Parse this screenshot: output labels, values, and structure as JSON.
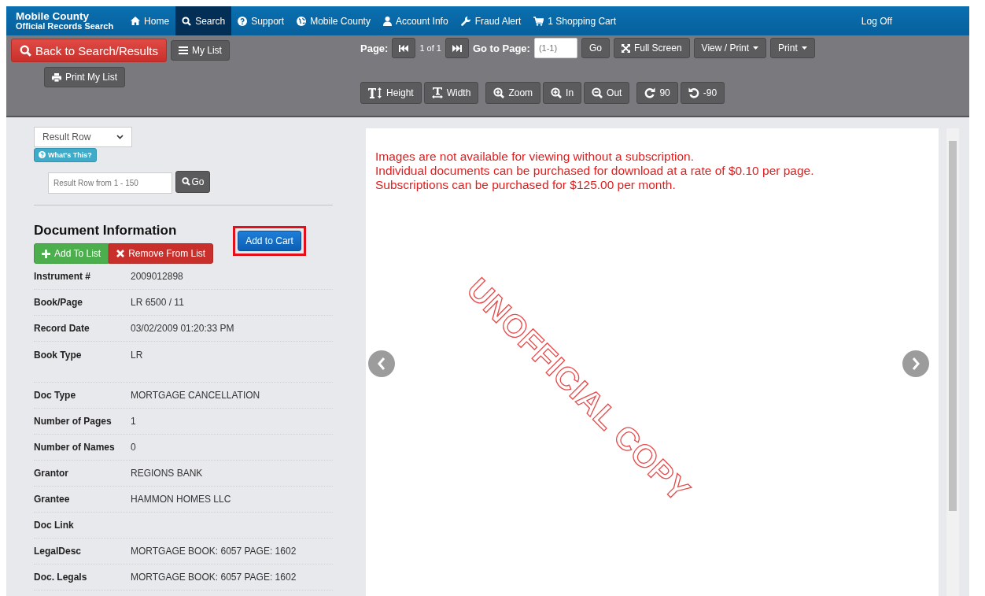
{
  "nav": {
    "logo_line1": "Mobile County",
    "logo_line2": "Official Records Search",
    "items": [
      {
        "label": "Home",
        "selected": false
      },
      {
        "label": "Search",
        "selected": true
      },
      {
        "label": "Support",
        "selected": false
      },
      {
        "label": "Mobile County",
        "selected": false
      },
      {
        "label": "Account Info",
        "selected": false
      },
      {
        "label": "Fraud Alert",
        "selected": false
      },
      {
        "label": "1 Shopping Cart",
        "selected": false
      }
    ],
    "logoff": "Log Off"
  },
  "toolbar": {
    "back": "Back to Search/Results",
    "my_list": "My List",
    "print_my_list": "Print My List",
    "page_label": "Page:",
    "page_count": "1 of 1",
    "goto_label": "Go to Page:",
    "goto_placeholder": "(1-1)",
    "go": "Go",
    "full_screen": "Full Screen",
    "view_print": "View / Print",
    "print": "Print",
    "tools": [
      {
        "label": "Height"
      },
      {
        "label": "Width"
      },
      {
        "label": "Zoom"
      },
      {
        "label": "In"
      },
      {
        "label": "Out"
      },
      {
        "label": "90"
      },
      {
        "label": "-90"
      }
    ]
  },
  "sidebar": {
    "result_select": "Result Row",
    "whats_this": "What's This?",
    "row_placeholder": "Result Row from 1 - 150",
    "go": "Go",
    "heading": "Document Information",
    "add_to_list": "Add To List",
    "remove_from_list": "Remove From List",
    "add_to_cart": "Add to Cart",
    "add_to_cart_highlighted": true,
    "rows": [
      {
        "label": "Instrument #",
        "value": "2009012898"
      },
      {
        "label": "Book/Page",
        "value": "LR 6500 / 11"
      },
      {
        "label": "Record Date",
        "value": "03/02/2009 01:20:33 PM"
      },
      {
        "label": "Book Type",
        "value": "LR"
      },
      {
        "label": "Doc Type",
        "value": "MORTGAGE CANCELLATION"
      },
      {
        "label": "Number of Pages",
        "value": "1"
      },
      {
        "label": "Number of Names",
        "value": "0"
      },
      {
        "label": "Grantor",
        "value": "REGIONS BANK"
      },
      {
        "label": "Grantee",
        "value": "HAMMON HOMES LLC"
      },
      {
        "label": "Doc Link"
      },
      {
        "label": "LegalDesc",
        "value": "MORTGAGE BOOK: 6057 PAGE: 1602"
      },
      {
        "label": "Doc. Legals",
        "value": "MORTGAGE BOOK: 6057 PAGE: 1602"
      }
    ]
  },
  "viewer": {
    "messages": [
      "Images are not available for viewing without a subscription.",
      "Individual documents can be purchased for download at a rate of $0.10 per page.",
      "Subscriptions can be purchased for $125.00 per month."
    ],
    "watermark": "UNOFFICIAL COPY"
  }
}
